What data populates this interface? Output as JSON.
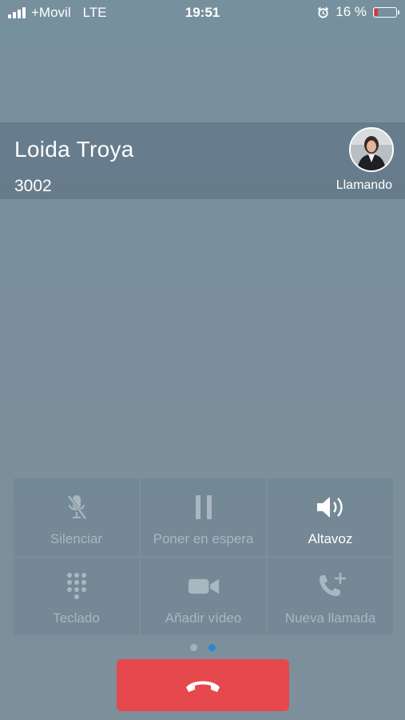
{
  "status_bar": {
    "carrier": "+Movil",
    "network": "LTE",
    "time": "19:51",
    "battery_percent": "16 %",
    "battery_level": 0.16,
    "icons": [
      "signal-icon",
      "alarm-icon",
      "battery-icon"
    ]
  },
  "call": {
    "contact_name": "Loida Troya",
    "number": "3002",
    "status": "Llamando"
  },
  "controls": [
    {
      "label": "Silenciar",
      "icon": "mic-off-icon",
      "active": false
    },
    {
      "label": "Poner en espera",
      "icon": "pause-icon",
      "active": false
    },
    {
      "label": "Altavoz",
      "icon": "speaker-icon",
      "active": true
    },
    {
      "label": "Teclado",
      "icon": "keypad-icon",
      "active": false
    },
    {
      "label": "Añadir vídeo",
      "icon": "video-camera-icon",
      "active": false
    },
    {
      "label": "Nueva llamada",
      "icon": "add-call-icon",
      "active": false
    }
  ],
  "pager": {
    "pages": 2,
    "current": 2
  },
  "end_call": {
    "icon": "hang-up-icon",
    "color": "#e5484d"
  }
}
